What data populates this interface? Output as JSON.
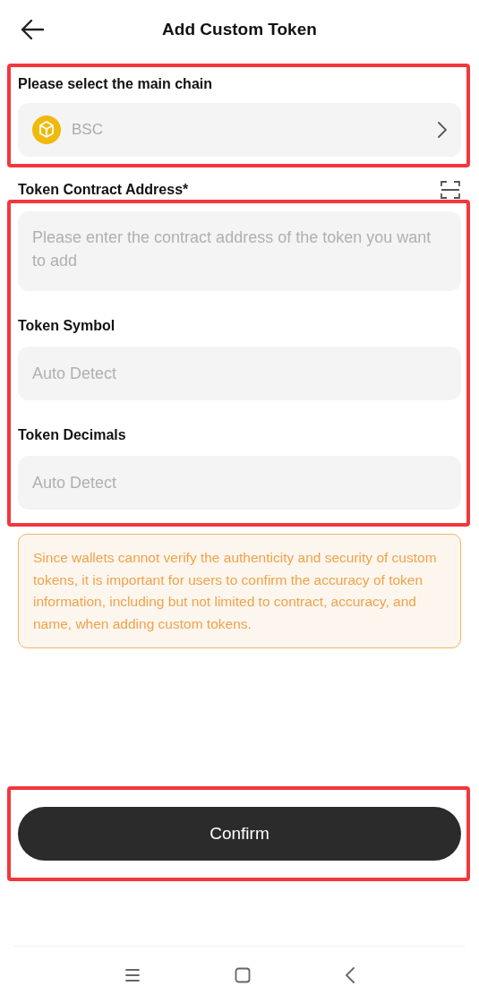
{
  "header": {
    "title": "Add Custom Token"
  },
  "chain_section": {
    "highlighted": true,
    "label": "Please select the main chain",
    "value": "BSC"
  },
  "contract_label": "Token Contract Address*",
  "token_section": {
    "highlighted": true,
    "fields": [
      {
        "kind": "multiline",
        "placeholder": "Please enter the contract address of the token you want to add"
      },
      {
        "kind": "single",
        "label": "Token Symbol",
        "placeholder": "Auto Detect"
      },
      {
        "kind": "single",
        "label": "Token Decimals",
        "placeholder": "Auto Detect"
      }
    ]
  },
  "warning": "Since wallets cannot verify the authenticity and security of custom tokens, it is important for users to confirm the accuracy of token information, including but not limited to contract, accuracy, and name, when adding custom tokens.",
  "confirm_section": {
    "highlighted": true,
    "button": "Confirm"
  }
}
